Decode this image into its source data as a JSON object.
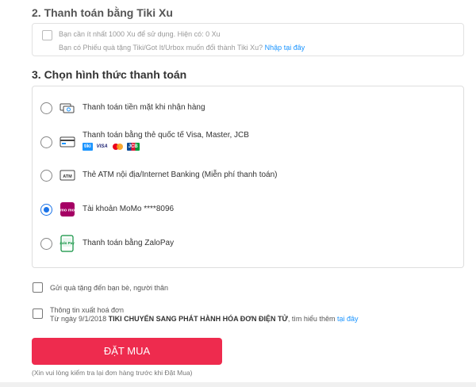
{
  "tiki_xu": {
    "title": "2. Thanh toán bằng Tiki Xu",
    "notice": "Bạn cần ít nhất 1000 Xu để sử dụng. Hiện có: 0 Xu",
    "voucher_text": "Bạn có Phiếu quà tặng Tiki/Got It/Urbox muốn đổi thành Tiki Xu?",
    "voucher_link": "Nhập tại đây"
  },
  "payment": {
    "title": "3. Chọn hình thức thanh toán",
    "options": [
      {
        "label": "Thanh toán tiền mặt khi nhận hàng",
        "icon": "cash-icon",
        "selected": false
      },
      {
        "label": "Thanh toán bằng thẻ quốc tế Visa, Master, JCB",
        "icon": "credit-card-icon",
        "selected": false,
        "logos": [
          "tiki",
          "VISA",
          "mastercard",
          "JCB"
        ]
      },
      {
        "label": "Thẻ ATM nội địa/Internet Banking (Miễn phí thanh toán)",
        "icon": "atm-icon",
        "selected": false
      },
      {
        "label": "Tài khoản MoMo ****8096",
        "icon": "momo-icon",
        "selected": true
      },
      {
        "label": "Thanh toán bằng ZaloPay",
        "icon": "zalopay-icon",
        "selected": false
      }
    ],
    "logos": {
      "tiki": "tiki",
      "visa": "VISA",
      "jcb": "JCB"
    },
    "atm_text": "ATM",
    "momo_text": "mo mo",
    "zalo_text": "Zalo Pay"
  },
  "extras": {
    "gift_label": "Gửi quà tặng đến bạn bè, người thân",
    "invoice_title": "Thông tin xuất hoá đơn",
    "invoice_text": "Từ ngày 9/1/2018",
    "invoice_bold": "TIKI CHUYỂN SANG PHÁT HÀNH HÓA ĐƠN ĐIỆN TỬ",
    "invoice_more": ", tìm hiểu thêm",
    "invoice_link": "tại đây"
  },
  "order": {
    "button_label": "ĐẶT MUA",
    "note": "(Xin vui lòng kiểm tra lại đơn hàng trước khi Đặt Mua)"
  },
  "colors": {
    "accent": "#1a94ff",
    "buy": "#ee2b4e",
    "radio_selected": "#1a73e8",
    "momo": "#a50064",
    "zalo": "#0a8f3c"
  }
}
